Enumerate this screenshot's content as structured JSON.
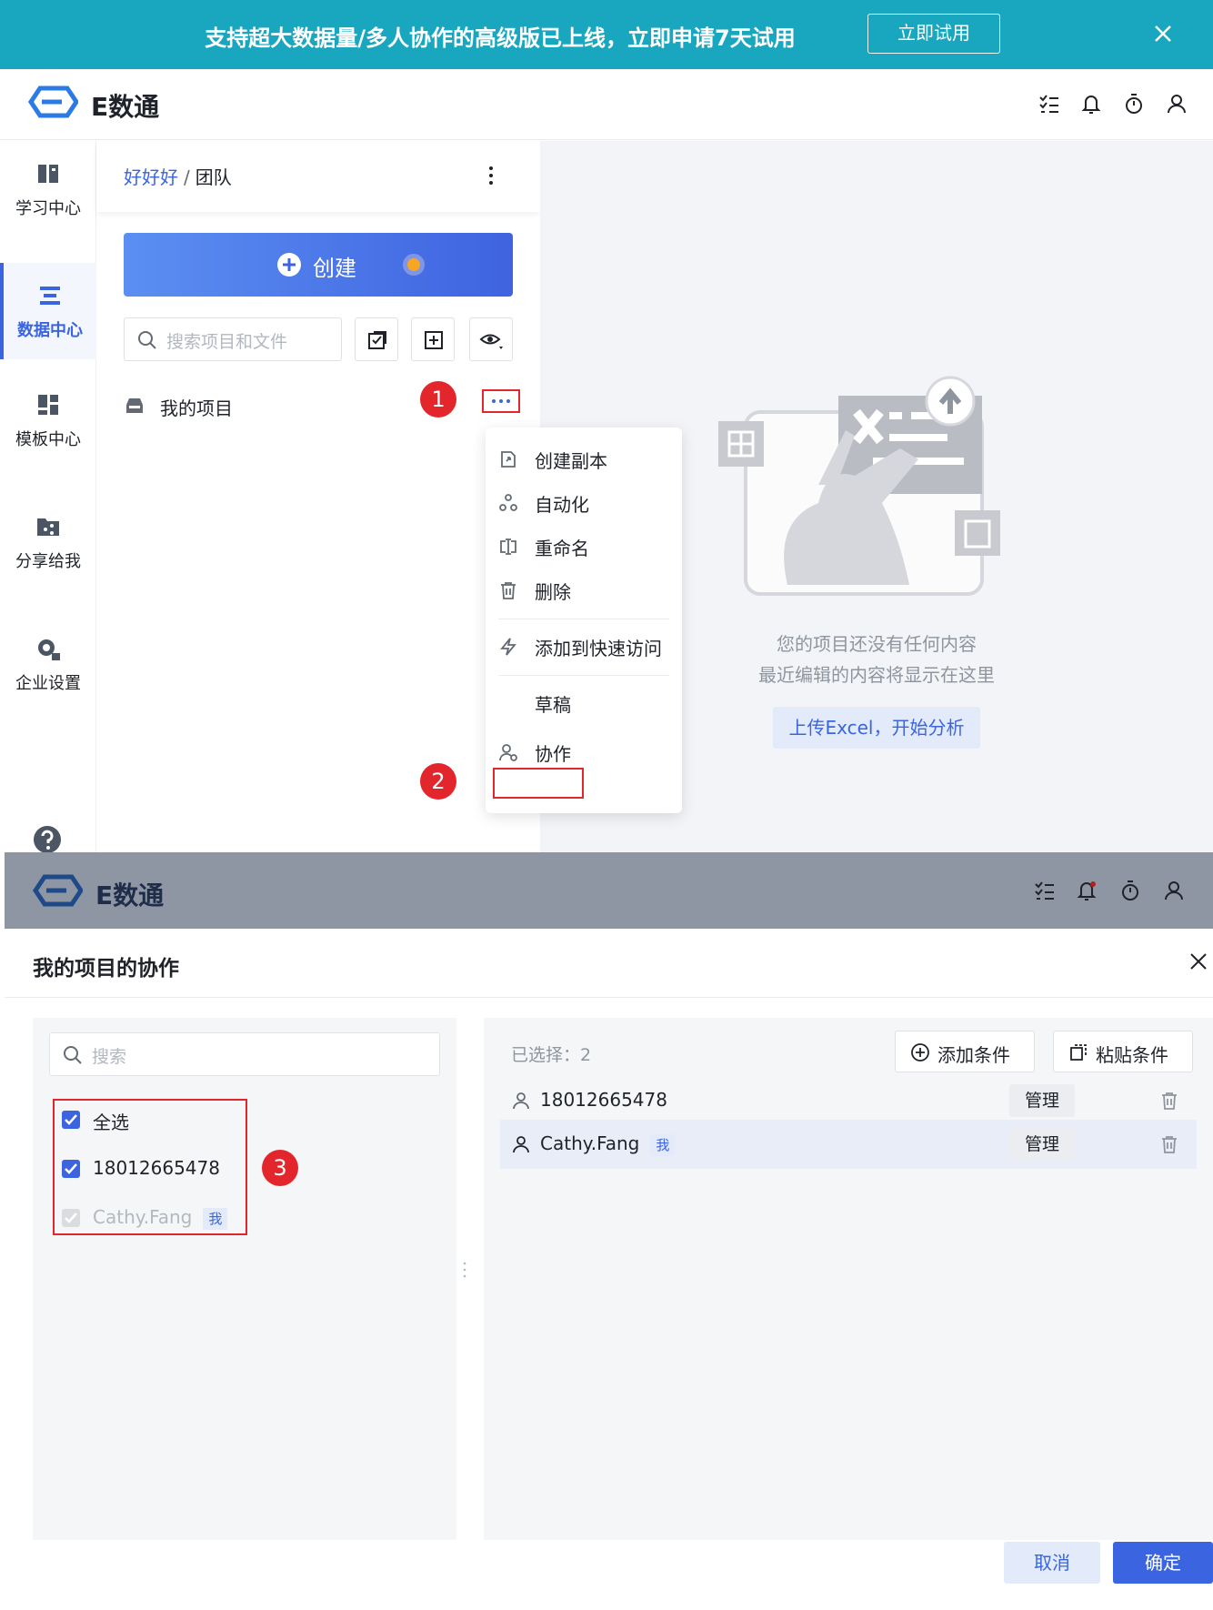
{
  "banner": {
    "text": "支持超大数据量/多人协作的高级版已上线，立即申请7天试用",
    "button_label": "立即试用"
  },
  "app": {
    "logo_text": "E数通"
  },
  "header_icons": [
    "task-list-icon",
    "bell-icon",
    "timer-icon",
    "user-icon"
  ],
  "sidebar": {
    "items": [
      {
        "label": "学习中心",
        "icon": "book-icon"
      },
      {
        "label": "数据中心",
        "icon": "database-icon",
        "active": true
      },
      {
        "label": "模板中心",
        "icon": "template-icon"
      },
      {
        "label": "分享给我",
        "icon": "share-icon"
      },
      {
        "label": "企业设置",
        "icon": "gear-icon"
      }
    ],
    "help_icon": "help-icon"
  },
  "breadcrumb": {
    "team_link": "好好好",
    "separator": "/",
    "current": "团队"
  },
  "create_button": {
    "label": "创建"
  },
  "search": {
    "placeholder": "搜索项目和文件"
  },
  "project": {
    "name": "我的项目"
  },
  "markers": {
    "m1": "1",
    "m2": "2",
    "m3": "3"
  },
  "context_menu": {
    "items": [
      {
        "label": "创建副本",
        "icon": "copy-icon"
      },
      {
        "label": "自动化",
        "icon": "automation-icon"
      },
      {
        "label": "重命名",
        "icon": "rename-icon"
      },
      {
        "label": "删除",
        "icon": "trash-icon"
      },
      {
        "label": "添加到快速访问",
        "icon": "lightning-icon"
      },
      {
        "label": "草稿",
        "icon": ""
      },
      {
        "label": "协作",
        "icon": "collaborate-icon"
      }
    ]
  },
  "empty_state": {
    "line1": "您的项目还没有任何内容",
    "line2": "最近编辑的内容将显示在这里",
    "upload_button": "上传Excel，开始分析"
  },
  "dialog": {
    "title": "我的项目的协作",
    "search_placeholder": "搜索",
    "checklist": [
      {
        "label": "全选",
        "checked": true
      },
      {
        "label": "18012665478",
        "checked": true
      },
      {
        "label": "Cathy.Fang",
        "checked": true,
        "disabled": true,
        "badge": "我"
      }
    ],
    "selected_label": "已选择：2",
    "add_condition": "添加条件",
    "paste_condition": "粘贴条件",
    "members": [
      {
        "name": "18012665478",
        "role": "管理"
      },
      {
        "name": "Cathy.Fang",
        "badge": "我",
        "role": "管理"
      }
    ],
    "cancel_label": "取消",
    "ok_label": "确定"
  },
  "colors": {
    "primary": "#3a64e0",
    "banner": "#18a7be",
    "marker": "#e3252c"
  }
}
